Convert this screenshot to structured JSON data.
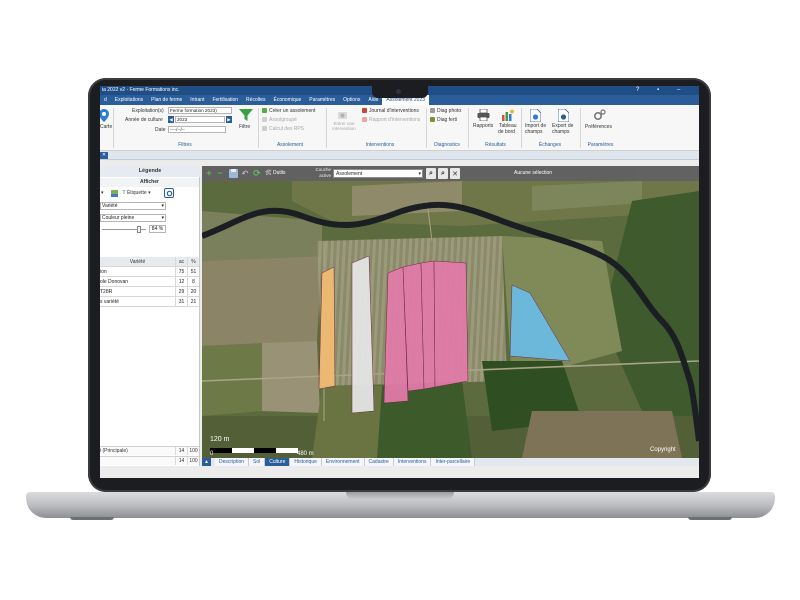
{
  "app": {
    "title": "ia 2022 v2 - Ferme Formations inc.",
    "window_buttons": [
      "?",
      "▪",
      "–"
    ]
  },
  "menu": {
    "items": [
      "d",
      "Exploitations",
      "Plan de ferme",
      "Intrant",
      "Fertilisation",
      "Récoltes",
      "Économique",
      "Paramètres",
      "Options",
      "Aide",
      "Assolement 2023"
    ],
    "active_index": 10
  },
  "ribbon": {
    "carte_label": "Carte",
    "filtres": {
      "exploitation_label": "Exploitation(s)",
      "exploitation_value": "Ferme formation 2023)",
      "annee_label": "Année de culture",
      "annee_value": "2023",
      "date_label": "Date",
      "date_value": "----/--/--",
      "filtre_button": "Filtre",
      "group": "Filtres"
    },
    "assolement": {
      "create": "Créer un assolement",
      "item2": "Assolgroupé",
      "item3": "Calcul des RPS",
      "group": "Assolement"
    },
    "interventions": {
      "enter": "Entrer une intervention",
      "journal": "Journal d'interventions",
      "rapport": "Rapport d'interventions",
      "group": "Interventions"
    },
    "diagnostics": {
      "diag_photo": "Diag photo",
      "diag_ferti": "Diag ferti",
      "group": "Diagnostics"
    },
    "resultats": {
      "rapports": "Rapports",
      "tableau_1": "Tableau",
      "tableau_2": "de bord",
      "group": "Résultats"
    },
    "echanges": {
      "import_1": "Import de",
      "import_2": "champs",
      "export_1": "Export de",
      "export_2": "champs",
      "group": "Échanges"
    },
    "parametres": {
      "preferences": "Préférences",
      "group": "Paramètres"
    }
  },
  "doc_tab": {
    "close": "✕"
  },
  "legend": {
    "title": "Légende",
    "afficher": "Afficher",
    "etiquette": "Étiquette",
    "variete_select": "Variété",
    "couleur_select": "Couleur pleine",
    "opacity": "84 %",
    "table": {
      "headers": [
        "Variété",
        "ac",
        "%"
      ],
      "rows": [
        [
          "ion",
          "75",
          "51"
        ],
        [
          "ole Donovan",
          "12",
          "8"
        ],
        [
          "T28R",
          "29",
          "20"
        ],
        [
          "s variété",
          "31",
          "21"
        ]
      ]
    },
    "footer_rows": [
      [
        "i (Principale)",
        "14",
        "100"
      ],
      [
        "",
        "14",
        "100"
      ]
    ]
  },
  "map_toolbar": {
    "outils": "Outils",
    "couche_label_1": "Couche",
    "couche_label_2": "active",
    "layer_value": "Assolement",
    "selection": "Aucune sélection"
  },
  "map": {
    "scale_top": "120 m",
    "scale_left": "0",
    "scale_right": "480 m",
    "copyright": "Copyright",
    "field_colors": {
      "variete_a": "#f0bb73",
      "variete_b": "#e4e4e4",
      "variete_c": "#e07aa6",
      "variete_d": "#6cbbe3"
    }
  },
  "bottom_tabs": [
    "Description",
    "Sol",
    "Culture",
    "Historique",
    "Environnement",
    "Cadastre",
    "Interventions",
    "Inter-parcellaire"
  ],
  "bottom_active": 2,
  "colors": {
    "brand": "#2a5d9a",
    "title_bar": "#1f4e86"
  }
}
